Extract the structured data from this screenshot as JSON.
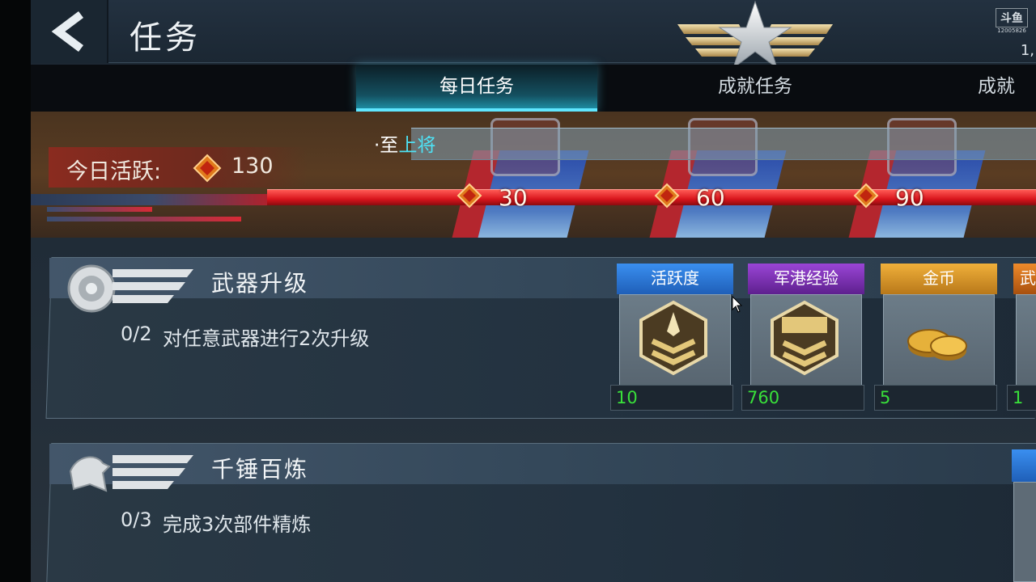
{
  "header": {
    "title": "任务",
    "corner_logo_mark": "斗鱼",
    "corner_logo_sub": "12005826",
    "corner_fragment": "1,"
  },
  "tabs": [
    {
      "label": "每日任务",
      "active": true
    },
    {
      "label": "成就任务",
      "active": false
    },
    {
      "label": "成就",
      "active": false
    }
  ],
  "activity": {
    "message_prefix": "·至",
    "message_highlight": "上将",
    "today_label": "今日活跃:",
    "today_value": "130",
    "milestones": [
      "30",
      "60",
      "90"
    ],
    "progress_fraction": 1.0
  },
  "tasks": [
    {
      "title": "武器升级",
      "progress": "0/2",
      "description": "对任意武器进行2次升级",
      "rewards": [
        {
          "label": "活跃度",
          "count": "10",
          "color": "#2f7fd6",
          "icon": "rank-chevron-icon"
        },
        {
          "label": "军港经验",
          "count": "760",
          "color": "#7a2fb0",
          "icon": "experience-badge-icon"
        },
        {
          "label": "金币",
          "count": "5",
          "color": "#d9951c",
          "icon": "gold-coins-icon"
        },
        {
          "label": "武",
          "count": "1",
          "color": "#d06a1a",
          "icon": "weapon-item-icon"
        }
      ]
    },
    {
      "title": "千锤百炼",
      "progress": "0/3",
      "description": "完成3次部件精炼",
      "rewards": []
    }
  ],
  "colors": {
    "accent_cyan": "#5fe6ff",
    "progress_red": "#d8141c",
    "count_green": "#39e03a"
  }
}
